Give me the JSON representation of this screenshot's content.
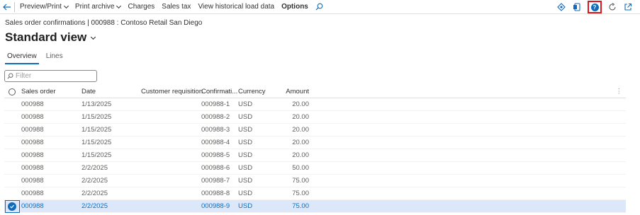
{
  "toolbar": {
    "items": [
      {
        "label": "Preview/Print",
        "dropdown": true
      },
      {
        "label": "Print archive",
        "dropdown": true
      },
      {
        "label": "Charges",
        "dropdown": false
      },
      {
        "label": "Sales tax",
        "dropdown": false
      },
      {
        "label": "View historical load data",
        "dropdown": false
      },
      {
        "label": "Options",
        "dropdown": false,
        "bold": true
      }
    ],
    "help_label": "?",
    "accent": "#0f6cbd",
    "highlight": "#e0161e"
  },
  "breadcrumb": "Sales order confirmations  |  000988 : Contoso Retail San Diego",
  "page_title": "Standard view",
  "tabs": [
    {
      "label": "Overview",
      "active": true
    },
    {
      "label": "Lines",
      "active": false
    }
  ],
  "filter": {
    "placeholder": "Filter"
  },
  "grid": {
    "columns": [
      "Sales order",
      "Date",
      "Customer requisition",
      "Confirmati...",
      "Currency",
      "Amount"
    ],
    "rows": [
      {
        "sales_order": "000988",
        "date": "1/13/2025",
        "customer_requisition": "",
        "confirmation": "000988-1",
        "currency": "USD",
        "amount": "20.00",
        "selected": false
      },
      {
        "sales_order": "000988",
        "date": "1/15/2025",
        "customer_requisition": "",
        "confirmation": "000988-2",
        "currency": "USD",
        "amount": "20.00",
        "selected": false
      },
      {
        "sales_order": "000988",
        "date": "1/15/2025",
        "customer_requisition": "",
        "confirmation": "000988-3",
        "currency": "USD",
        "amount": "20.00",
        "selected": false
      },
      {
        "sales_order": "000988",
        "date": "1/15/2025",
        "customer_requisition": "",
        "confirmation": "000988-4",
        "currency": "USD",
        "amount": "20.00",
        "selected": false
      },
      {
        "sales_order": "000988",
        "date": "1/15/2025",
        "customer_requisition": "",
        "confirmation": "000988-5",
        "currency": "USD",
        "amount": "20.00",
        "selected": false
      },
      {
        "sales_order": "000988",
        "date": "2/2/2025",
        "customer_requisition": "",
        "confirmation": "000988-6",
        "currency": "USD",
        "amount": "50.00",
        "selected": false
      },
      {
        "sales_order": "000988",
        "date": "2/2/2025",
        "customer_requisition": "",
        "confirmation": "000988-7",
        "currency": "USD",
        "amount": "75.00",
        "selected": false
      },
      {
        "sales_order": "000988",
        "date": "2/2/2025",
        "customer_requisition": "",
        "confirmation": "000988-8",
        "currency": "USD",
        "amount": "75.00",
        "selected": false
      },
      {
        "sales_order": "000988",
        "date": "2/2/2025",
        "customer_requisition": "",
        "confirmation": "000988-9",
        "currency": "USD",
        "amount": "75.00",
        "selected": true
      }
    ]
  }
}
